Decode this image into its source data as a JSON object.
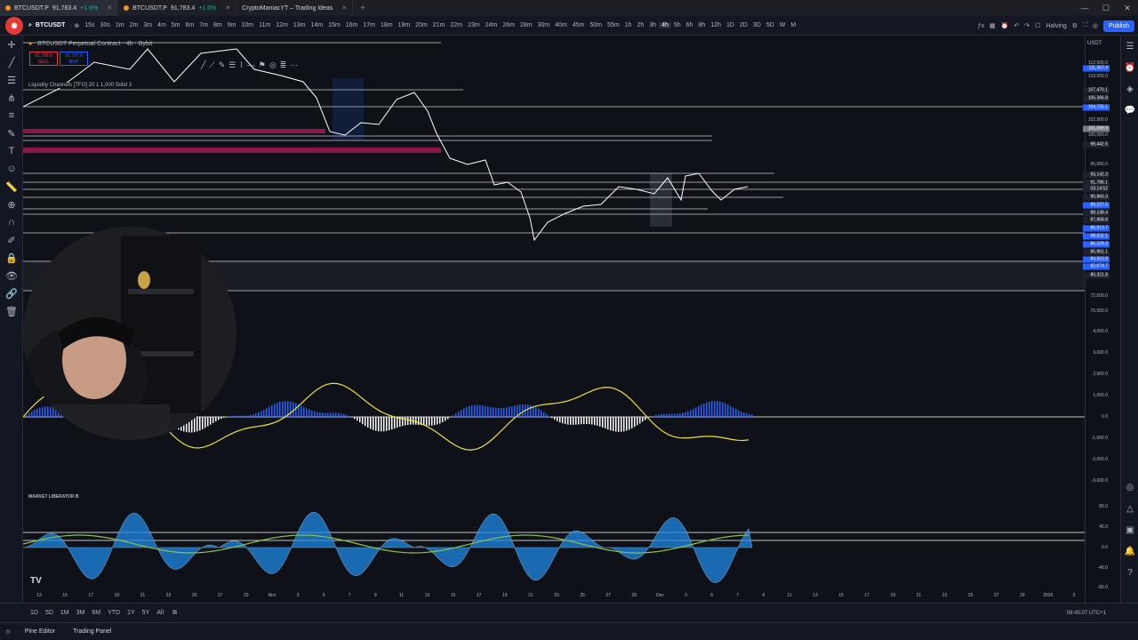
{
  "browser": {
    "tabs": [
      {
        "title": "BTCUSDT.P",
        "price": "91,783.4",
        "change": "+1.6%"
      },
      {
        "title": "BTCUSDT.P",
        "price": "91,783.4",
        "change": "+1.6%"
      },
      {
        "title": "CryptoManiacYT – Trading Ideas"
      }
    ],
    "new_tab": "+"
  },
  "toolbar": {
    "symbol": "BTCUSDT",
    "timeframes": [
      "15s",
      "30s",
      "1m",
      "2m",
      "3m",
      "4m",
      "5m",
      "6m",
      "7m",
      "8m",
      "9m",
      "10m",
      "11m",
      "12m",
      "13m",
      "14m",
      "15m",
      "16m",
      "17m",
      "18m",
      "19m",
      "20m",
      "21m",
      "22m",
      "23m",
      "24m",
      "26m",
      "28m",
      "30m",
      "40m",
      "45m",
      "50m",
      "55m",
      "1h",
      "2h",
      "3h",
      "4h",
      "5h",
      "6h",
      "8h",
      "12h",
      "1D",
      "2D",
      "3D",
      "5D",
      "W",
      "M"
    ],
    "selected_timeframe": "4h",
    "halving_label": "Halving",
    "publish_label": "Publish"
  },
  "chart": {
    "legend_title": "BTCUSDT Perpetual Contract · 4h · Bybit",
    "sell_price": "91,796.9",
    "sell_label": "SELL",
    "buy_price": "91,797.0",
    "buy_label": "BUY",
    "indicator_label": "Liquidity Channels [TFO] 20 1 1,000 Solid 3",
    "sub_indicator_label": "MARKET LIBERATOR B",
    "currency": "USDT",
    "price_labels": [
      "112,500.0",
      "110,000.0",
      "102,500.0",
      "100,000.0",
      "95,000.0",
      "72,500.0",
      "70,000.0"
    ],
    "price_badges": [
      {
        "text": "111,367.4",
        "color": "#2962ff"
      },
      {
        "text": "107,470.1",
        "color": "#1e222d"
      },
      {
        "text": "106,366.8",
        "color": "#1e222d"
      },
      {
        "text": "104,725.1",
        "color": "#2962ff"
      },
      {
        "text": "101,089.9",
        "color": "#787b86"
      },
      {
        "text": "98,442.5",
        "color": "#1e222d"
      },
      {
        "text": "93,142.3",
        "color": "#1e222d"
      },
      {
        "text": "91,786.1",
        "color": "#1e222d"
      },
      {
        "text": "03:14:52",
        "color": "#1e222d"
      },
      {
        "text": "90,860.3",
        "color": "#1e222d"
      },
      {
        "text": "89,227.5",
        "color": "#2962ff"
      },
      {
        "text": "88,138.4",
        "color": "#1e222d"
      },
      {
        "text": "87,958.8",
        "color": "#1e222d"
      },
      {
        "text": "86,919.7",
        "color": "#2962ff"
      },
      {
        "text": "86,611.1",
        "color": "#2962ff"
      },
      {
        "text": "86,329.3",
        "color": "#2962ff"
      },
      {
        "text": "85,961.1",
        "color": "#1e222d"
      },
      {
        "text": "84,915.9",
        "color": "#2962ff"
      },
      {
        "text": "82,674.7",
        "color": "#2962ff"
      },
      {
        "text": "80,321.8",
        "color": "#1e222d"
      }
    ],
    "macd_labels": [
      "4,000.0",
      "3,000.0",
      "2,000.0",
      "1,000.0",
      "0.0",
      "-1,000.0",
      "-2,000.0",
      "-3,000.0"
    ],
    "osc_labels": [
      "80.0",
      "40.0",
      "0.0",
      "-40.0",
      "-80.0"
    ],
    "x_labels": [
      "13",
      "15",
      "17",
      "19",
      "21",
      "23",
      "25",
      "27",
      "29",
      "Nov",
      "3",
      "5",
      "7",
      "9",
      "11",
      "13",
      "15",
      "17",
      "19",
      "21",
      "23",
      "25",
      "27",
      "29",
      "Dec",
      "3",
      "5",
      "7",
      "9",
      "11",
      "13",
      "15",
      "17",
      "19",
      "21",
      "23",
      "25",
      "27",
      "29",
      "2026",
      "3"
    ],
    "tv_mark": "TV"
  },
  "bottom": {
    "ranges": [
      "1D",
      "5D",
      "1M",
      "3M",
      "6M",
      "YTD",
      "1Y",
      "5Y",
      "All"
    ],
    "clock": "09:45:07 UTC+1"
  },
  "footer": {
    "pine_editor": "Pine Editor",
    "trading_panel": "Trading Panel"
  },
  "colors": {
    "accent": "#2962ff",
    "bearish": "#f23645",
    "bullish": "#26a69a",
    "macd_signal": "#f0e040"
  }
}
